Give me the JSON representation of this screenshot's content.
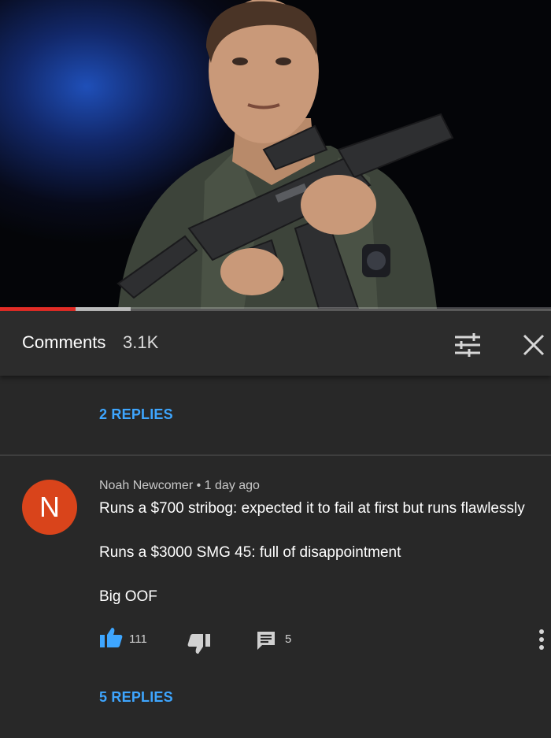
{
  "video": {
    "progress_played": 0.137,
    "progress_buffered": 0.237
  },
  "header": {
    "title": "Comments",
    "count": "3.1K",
    "sort_icon": "sort-sliders-icon",
    "close_icon": "close-icon"
  },
  "thread_prev": {
    "replies_label": "2 REPLIES"
  },
  "comment": {
    "avatar_letter": "N",
    "avatar_color": "#d9441b",
    "author": "Noah Newcomer",
    "separator": "•",
    "time": "1 day ago",
    "lines": [
      "Runs a $700 stribog: expected it to fail at first but runs flawlessly",
      "Runs a $3000 SMG 45: full of disappointment",
      "Big OOF"
    ],
    "likes": "111",
    "replies_count": "5",
    "replies_label": "5 REPLIES"
  },
  "colors": {
    "background": "#282828",
    "accent_link": "#3ea6ff",
    "progress_red": "#e52d27"
  }
}
